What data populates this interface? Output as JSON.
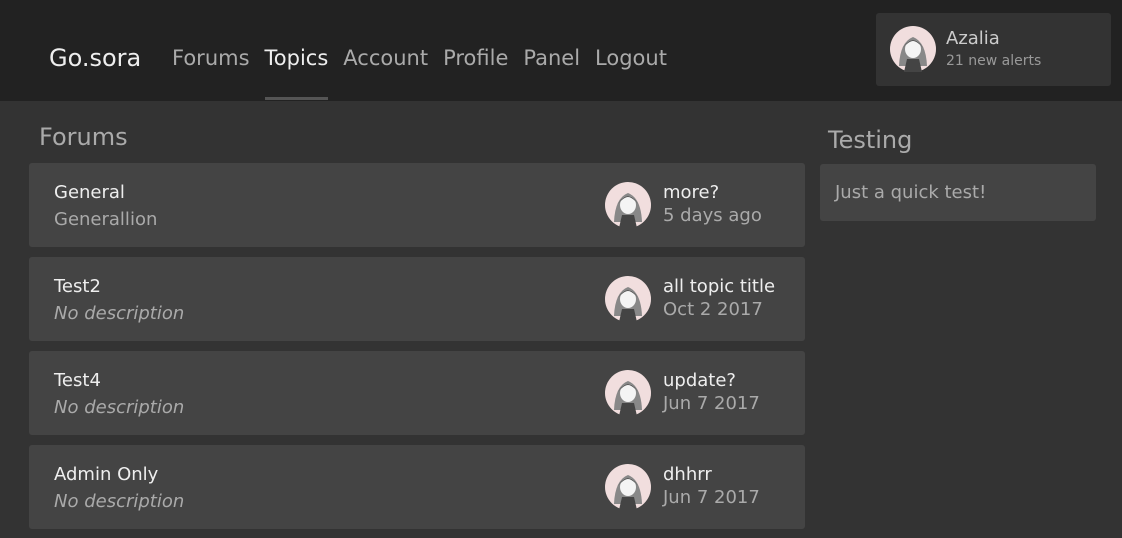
{
  "header": {
    "brand": "Go.sora",
    "nav": [
      "Forums",
      "Topics",
      "Account",
      "Profile",
      "Panel",
      "Logout"
    ],
    "active_nav": "Topics",
    "user": {
      "name": "Azalia",
      "alerts": "21 new alerts",
      "avatar_icon": "user-avatar-icon"
    }
  },
  "main": {
    "title": "Forums",
    "forums": [
      {
        "name": "General",
        "description": "Generallion",
        "last_topic": "more?",
        "last_time": "5 days ago"
      },
      {
        "name": "Test2",
        "description": "No description",
        "last_topic": "all topic title",
        "last_time": "Oct 2 2017"
      },
      {
        "name": "Test4",
        "description": "No description",
        "last_topic": "update?",
        "last_time": "Jun 7 2017"
      },
      {
        "name": "Admin Only",
        "description": "No description",
        "last_topic": "dhhrr",
        "last_time": "Jun 7 2017"
      }
    ]
  },
  "sidebar": {
    "widget_title": "Testing",
    "widget_text": "Just a quick test!"
  },
  "colors": {
    "header_bg": "#222222",
    "page_bg": "#333333",
    "card_bg": "#444444",
    "text_primary": "#eeeeee",
    "text_secondary": "#aaaaaa"
  }
}
